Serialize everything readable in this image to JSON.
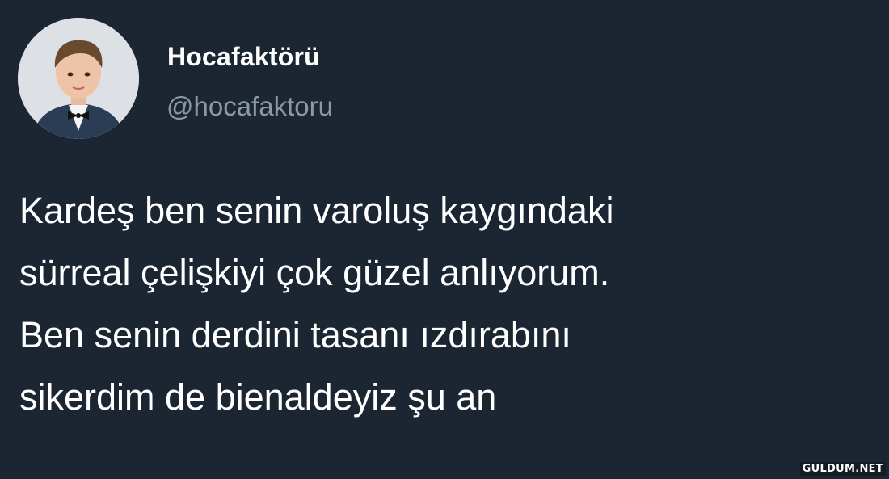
{
  "tweet": {
    "display_name": "Hocafaktörü",
    "handle": "@hocafaktoru",
    "text": "Kardeş ben senin varoluş kaygındaki\nsürreal çelişkiyi çok güzel anlıyorum.\nBen senin derdini tasanı ızdırabını\nsikerdim de bienaldeyiz şu an"
  },
  "watermark": "GULDUM.NET",
  "colors": {
    "background": "#1c2532",
    "text": "#ffffff",
    "handle": "#8b98a5"
  }
}
